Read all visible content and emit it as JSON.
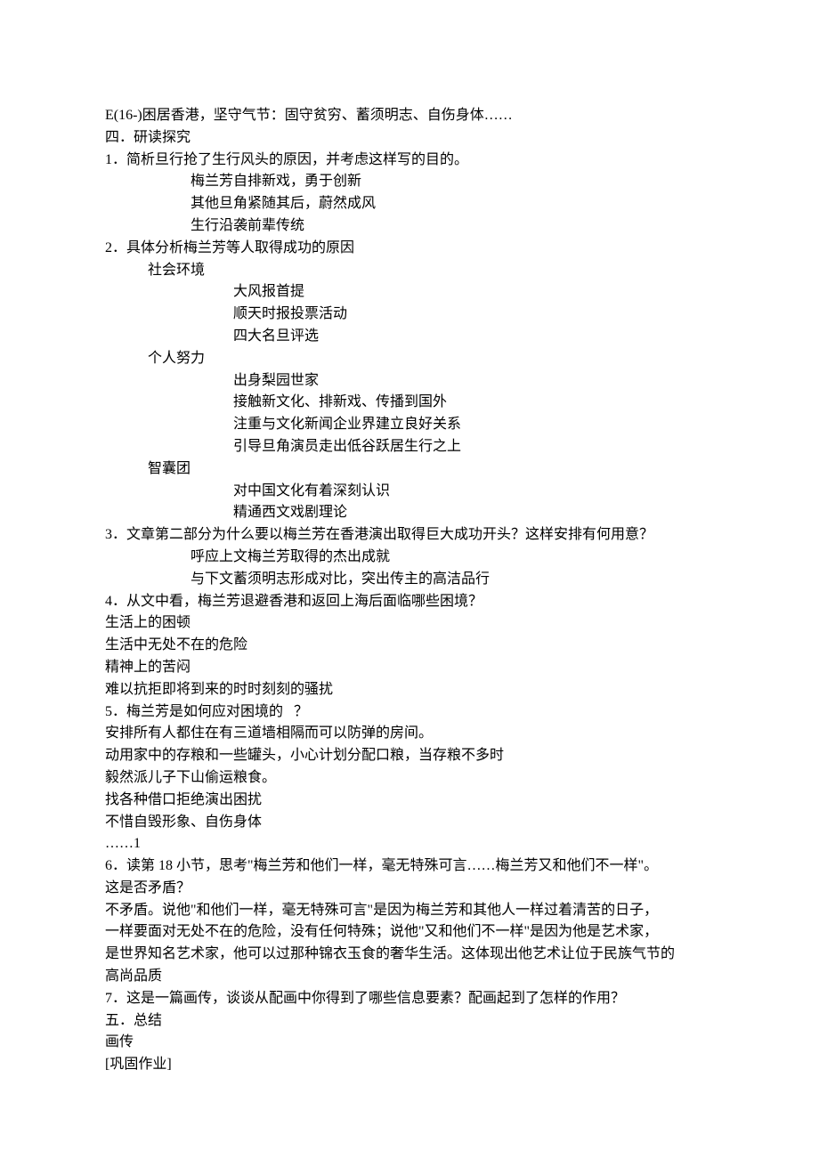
{
  "lines": [
    {
      "text": "E(16-)困居香港，坚守气节：固守贫穷、蓄须明志、自伤身体……",
      "class": ""
    },
    {
      "text": "四．研读探究",
      "class": ""
    },
    {
      "text": "1．简析旦行抢了生行风头的原因，并考虑这样写的目的。",
      "class": ""
    },
    {
      "text": "梅兰芳自排新戏，勇于创新",
      "class": "indent2"
    },
    {
      "text": "其他旦角紧随其后，蔚然成风",
      "class": "indent2"
    },
    {
      "text": "生行沿袭前辈传统",
      "class": "indent2"
    },
    {
      "text": "2．具体分析梅兰芳等人取得成功的原因",
      "class": ""
    },
    {
      "text": "社会环境",
      "class": "indent1"
    },
    {
      "text": "大风报首提",
      "class": "indent3"
    },
    {
      "text": "顺天时报投票活动",
      "class": "indent3"
    },
    {
      "text": "四大名旦评选",
      "class": "indent3"
    },
    {
      "text": "个人努力",
      "class": "indent1"
    },
    {
      "text": "出身梨园世家",
      "class": "indent3"
    },
    {
      "text": "接触新文化、排新戏、传播到国外",
      "class": "indent3"
    },
    {
      "text": "注重与文化新闻企业界建立良好关系",
      "class": "indent3"
    },
    {
      "text": "引导旦角演员走出低谷跃居生行之上",
      "class": "indent3"
    },
    {
      "text": "智囊团",
      "class": "indent1"
    },
    {
      "text": "对中国文化有着深刻认识",
      "class": "indent3"
    },
    {
      "text": "精通西文戏剧理论",
      "class": "indent3"
    },
    {
      "text": "3．文章第二部分为什么要以梅兰芳在香港演出取得巨大成功开头？这样安排有何用意？",
      "class": ""
    },
    {
      "text": "呼应上文梅兰芳取得的杰出成就",
      "class": "indent2"
    },
    {
      "text": "与下文蓄须明志形成对比，突出传主的高洁品行",
      "class": "indent2"
    },
    {
      "text": "4．从文中看，梅兰芳退避香港和返回上海后面临哪些困境？",
      "class": ""
    },
    {
      "text": "生活上的困顿",
      "class": ""
    },
    {
      "text": "生活中无处不在的危险",
      "class": ""
    },
    {
      "text": "精神上的苦闷",
      "class": ""
    },
    {
      "text": "难以抗拒即将到来的时时刻刻的骚扰",
      "class": ""
    },
    {
      "text": "5．梅兰芳是如何应对困境的   ？",
      "class": ""
    },
    {
      "text": "安排所有人都住在有三道墙相隔而可以防弹的房间。",
      "class": ""
    },
    {
      "text": "动用家中的存粮和一些罐头，小心计划分配口粮，当存粮不多时",
      "class": ""
    },
    {
      "text": "毅然派儿子下山偷运粮食。",
      "class": ""
    },
    {
      "text": "找各种借口拒绝演出困扰",
      "class": ""
    },
    {
      "text": "不惜自毁形象、自伤身体",
      "class": ""
    },
    {
      "text": "……1",
      "class": ""
    },
    {
      "text": "6．读第 18 小节，思考\"梅兰芳和他们一样，毫无特殊可言……梅兰芳又和他们不一样\"。",
      "class": ""
    },
    {
      "text": "这是否矛盾？",
      "class": ""
    },
    {
      "text": "不矛盾。说他\"和他们一样，毫无特殊可言\"是因为梅兰芳和其他人一样过着清苦的日子，",
      "class": ""
    },
    {
      "text": "一样要面对无处不在的危险，没有任何特殊；说他\"又和他们不一样\"是因为他是艺术家，",
      "class": ""
    },
    {
      "text": "是世界知名艺术家，他可以过那种锦衣玉食的奢华生活。这体现出他艺术让位于民族气节的",
      "class": ""
    },
    {
      "text": "高尚品质",
      "class": ""
    },
    {
      "text": "7．这是一篇画传，谈谈从配画中你得到了哪些信息要素？配画起到了怎样的作用？",
      "class": ""
    },
    {
      "text": "五．总结",
      "class": ""
    },
    {
      "text": "画传",
      "class": ""
    },
    {
      "text": "[巩固作业]",
      "class": ""
    }
  ]
}
